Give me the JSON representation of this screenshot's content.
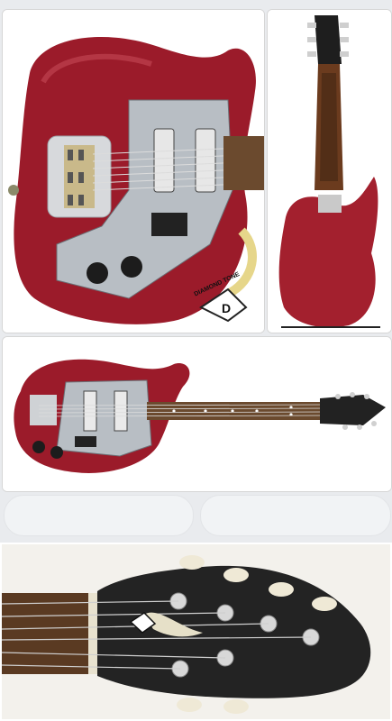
{
  "images": [
    {
      "id": "guitar-front-closeup",
      "interactable": true
    },
    {
      "id": "guitar-back",
      "interactable": true
    },
    {
      "id": "guitar-full-front",
      "interactable": true
    },
    {
      "id": "guitar-headstock",
      "interactable": true
    }
  ],
  "brand": {
    "logo_text": "DIAMOND TONE",
    "logo_letter": "D"
  },
  "pills": [
    {
      "label": ""
    },
    {
      "label": ""
    }
  ],
  "colors": {
    "body_red": "#9b1b2a",
    "pickguard": "#b8bec4",
    "neck_wood": "#6b4a2e",
    "headstock": "#222222",
    "background": "#e9ebee"
  }
}
